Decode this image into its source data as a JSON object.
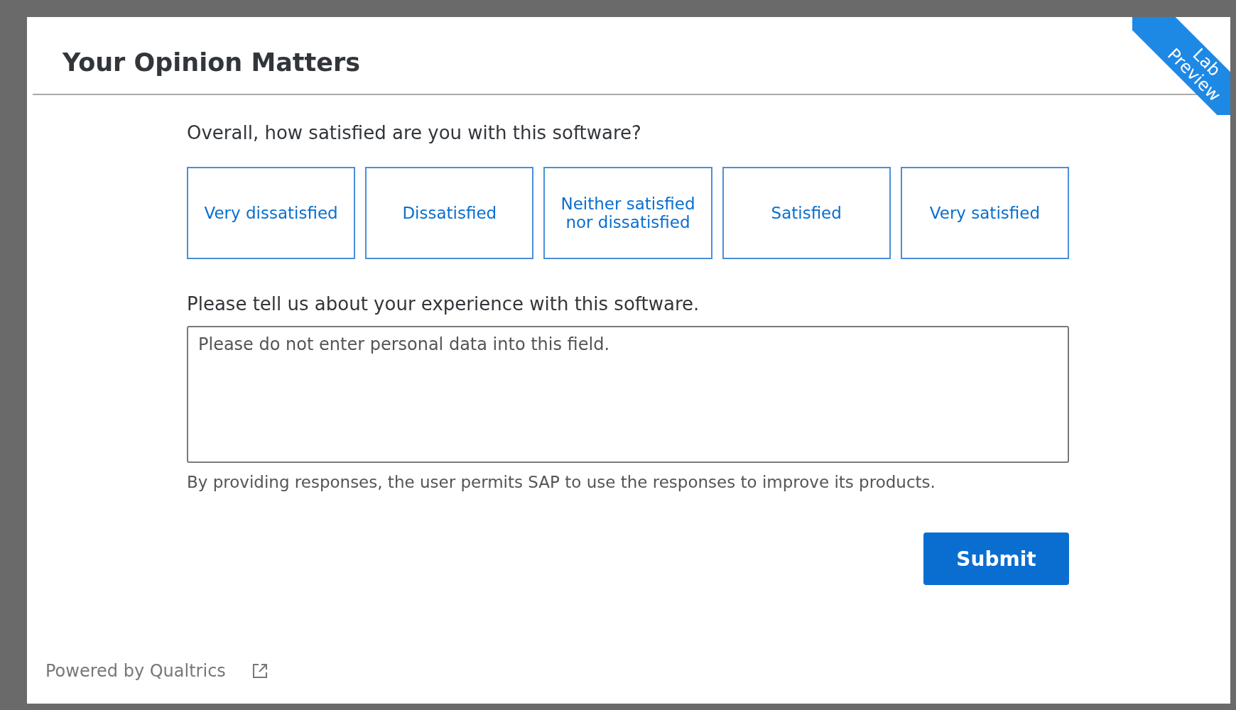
{
  "dialog": {
    "title": "Your Opinion Matters",
    "ribbon": "Lab Preview"
  },
  "question": {
    "label": "Overall, how satisfied are you with this software?",
    "options": [
      {
        "label": "Very dissatisfied",
        "selected": false
      },
      {
        "label": "Dissatisfied",
        "selected": false
      },
      {
        "label": "Neither satisfied nor dissatisfied",
        "selected": false
      },
      {
        "label": "Satisfied",
        "selected": false
      },
      {
        "label": "Very satisfied",
        "selected": false
      }
    ]
  },
  "comment": {
    "label": "Please tell us about your experience with this software.",
    "placeholder": "Please do not enter personal data into this field."
  },
  "consent": "By providing responses, the user permits SAP to use the responses to improve its products.",
  "submit": "Submit",
  "footer": {
    "powered_by": "Powered by Qualtrics"
  }
}
